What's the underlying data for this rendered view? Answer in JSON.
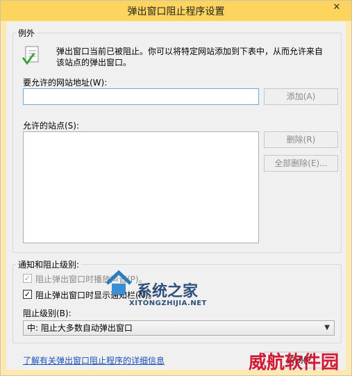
{
  "window": {
    "title": "弹出窗口阻止程序设置",
    "close_glyph": "✕"
  },
  "exceptions": {
    "group_label": "例外",
    "description_line1": "弹出窗口当前已被阻止。你可以将特定网站添加到下表中，从而允许来自",
    "description_line2": "该站点的弹出窗口。",
    "address_label": "要允许的网站地址(W):",
    "address_value": "",
    "add_button": "添加(A)",
    "allowed_sites_label": "允许的站点(S):",
    "allowed_sites": [],
    "remove_button": "删除(R)",
    "remove_all_button": "全部删除(E)..."
  },
  "notifications": {
    "group_label": "通知和阻止级别:",
    "play_sound_label": "阻止弹出窗口时播放声音(P)。",
    "play_sound_checked": true,
    "show_bar_label": "阻止弹出窗口时显示通知栏(N)。",
    "show_bar_checked": true,
    "block_level_label": "阻止级别(B):",
    "block_level_value": "中: 阻止大多数自动弹出窗口"
  },
  "footer": {
    "learn_more_link": "了解有关弹出窗口阻止程序的详细信息",
    "close_button": "关闭(C)"
  },
  "overlays": {
    "watermark_site_cn": "系统之家",
    "watermark_site_url": "XITONGZHIJIA.NET",
    "watermark_corner": "威航软件园"
  },
  "icons": {
    "info_icon": "checklist-icon"
  }
}
